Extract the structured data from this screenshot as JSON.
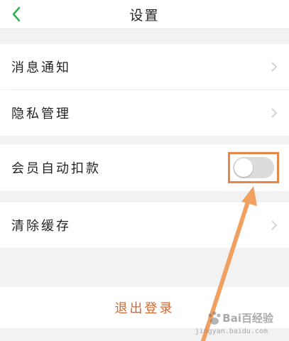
{
  "header": {
    "title": "设置"
  },
  "settings": {
    "notifications_label": "消息通知",
    "privacy_label": "隐私管理",
    "auto_deduct_label": "会员自动扣款",
    "auto_deduct_enabled": false,
    "clear_cache_label": "清除缓存",
    "logout_label": "退出登录"
  },
  "watermark": {
    "brand": "Bai百经验",
    "site": "jingyan.baidu.com"
  },
  "colors": {
    "accent_green": "#2bb24c",
    "annotation_orange": "#e6874a",
    "logout_text": "#d9652a"
  }
}
